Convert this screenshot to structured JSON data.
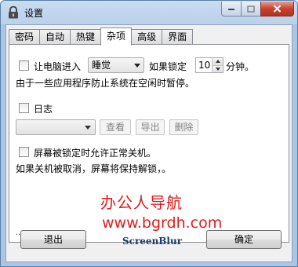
{
  "window": {
    "title": "设置"
  },
  "tabs": [
    {
      "label": "密码",
      "active": false
    },
    {
      "label": "自动",
      "active": false
    },
    {
      "label": "热键",
      "active": false
    },
    {
      "label": "杂项",
      "active": true
    },
    {
      "label": "高级",
      "active": false
    },
    {
      "label": "界面",
      "active": false
    }
  ],
  "sleep": {
    "checkbox_label": "让电脑进入",
    "mode_value": "睡觉",
    "after_label": "如果锁定",
    "minutes_value": "10",
    "unit_label": "分钟。",
    "note": "由于一些应用程序防止系统在空闲时暂停。"
  },
  "log": {
    "checkbox_label": "日志",
    "view_button": "查看",
    "export_button": "导出",
    "delete_button": "删除"
  },
  "shutdown": {
    "checkbox_label": "屏幕被锁定时允许正常关机。",
    "note": "如果关机被取消，屏幕将保持解锁，。"
  },
  "watermark": {
    "line1": "办公人导航",
    "line2": "www.bgrdh.com"
  },
  "ellipsis": "...",
  "footer": {
    "exit_button": "退出",
    "brand": "ScreenBlur",
    "ok_button": "确定"
  }
}
